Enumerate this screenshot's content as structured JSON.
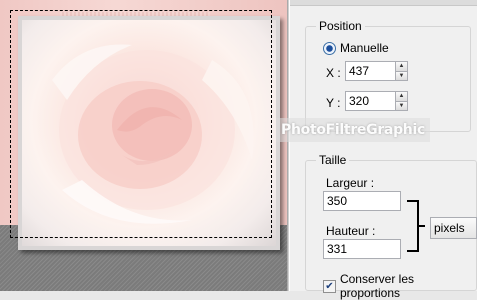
{
  "position": {
    "title": "Position",
    "mode_label": "Manuelle",
    "x_label": "X :",
    "x_value": "437",
    "y_label": "Y :",
    "y_value": "320"
  },
  "size": {
    "title": "Taille",
    "width_label": "Largeur :",
    "width_value": "350",
    "height_label": "Hauteur :",
    "height_value": "331",
    "unit": "pixels",
    "keep_proportions_label": "Conserver les proportions",
    "keep_proportions_checked": true
  },
  "watermark": "PhotoFiltreGraphic",
  "icons": {
    "spin_up": "▲",
    "spin_down": "▼",
    "check": "✔"
  }
}
